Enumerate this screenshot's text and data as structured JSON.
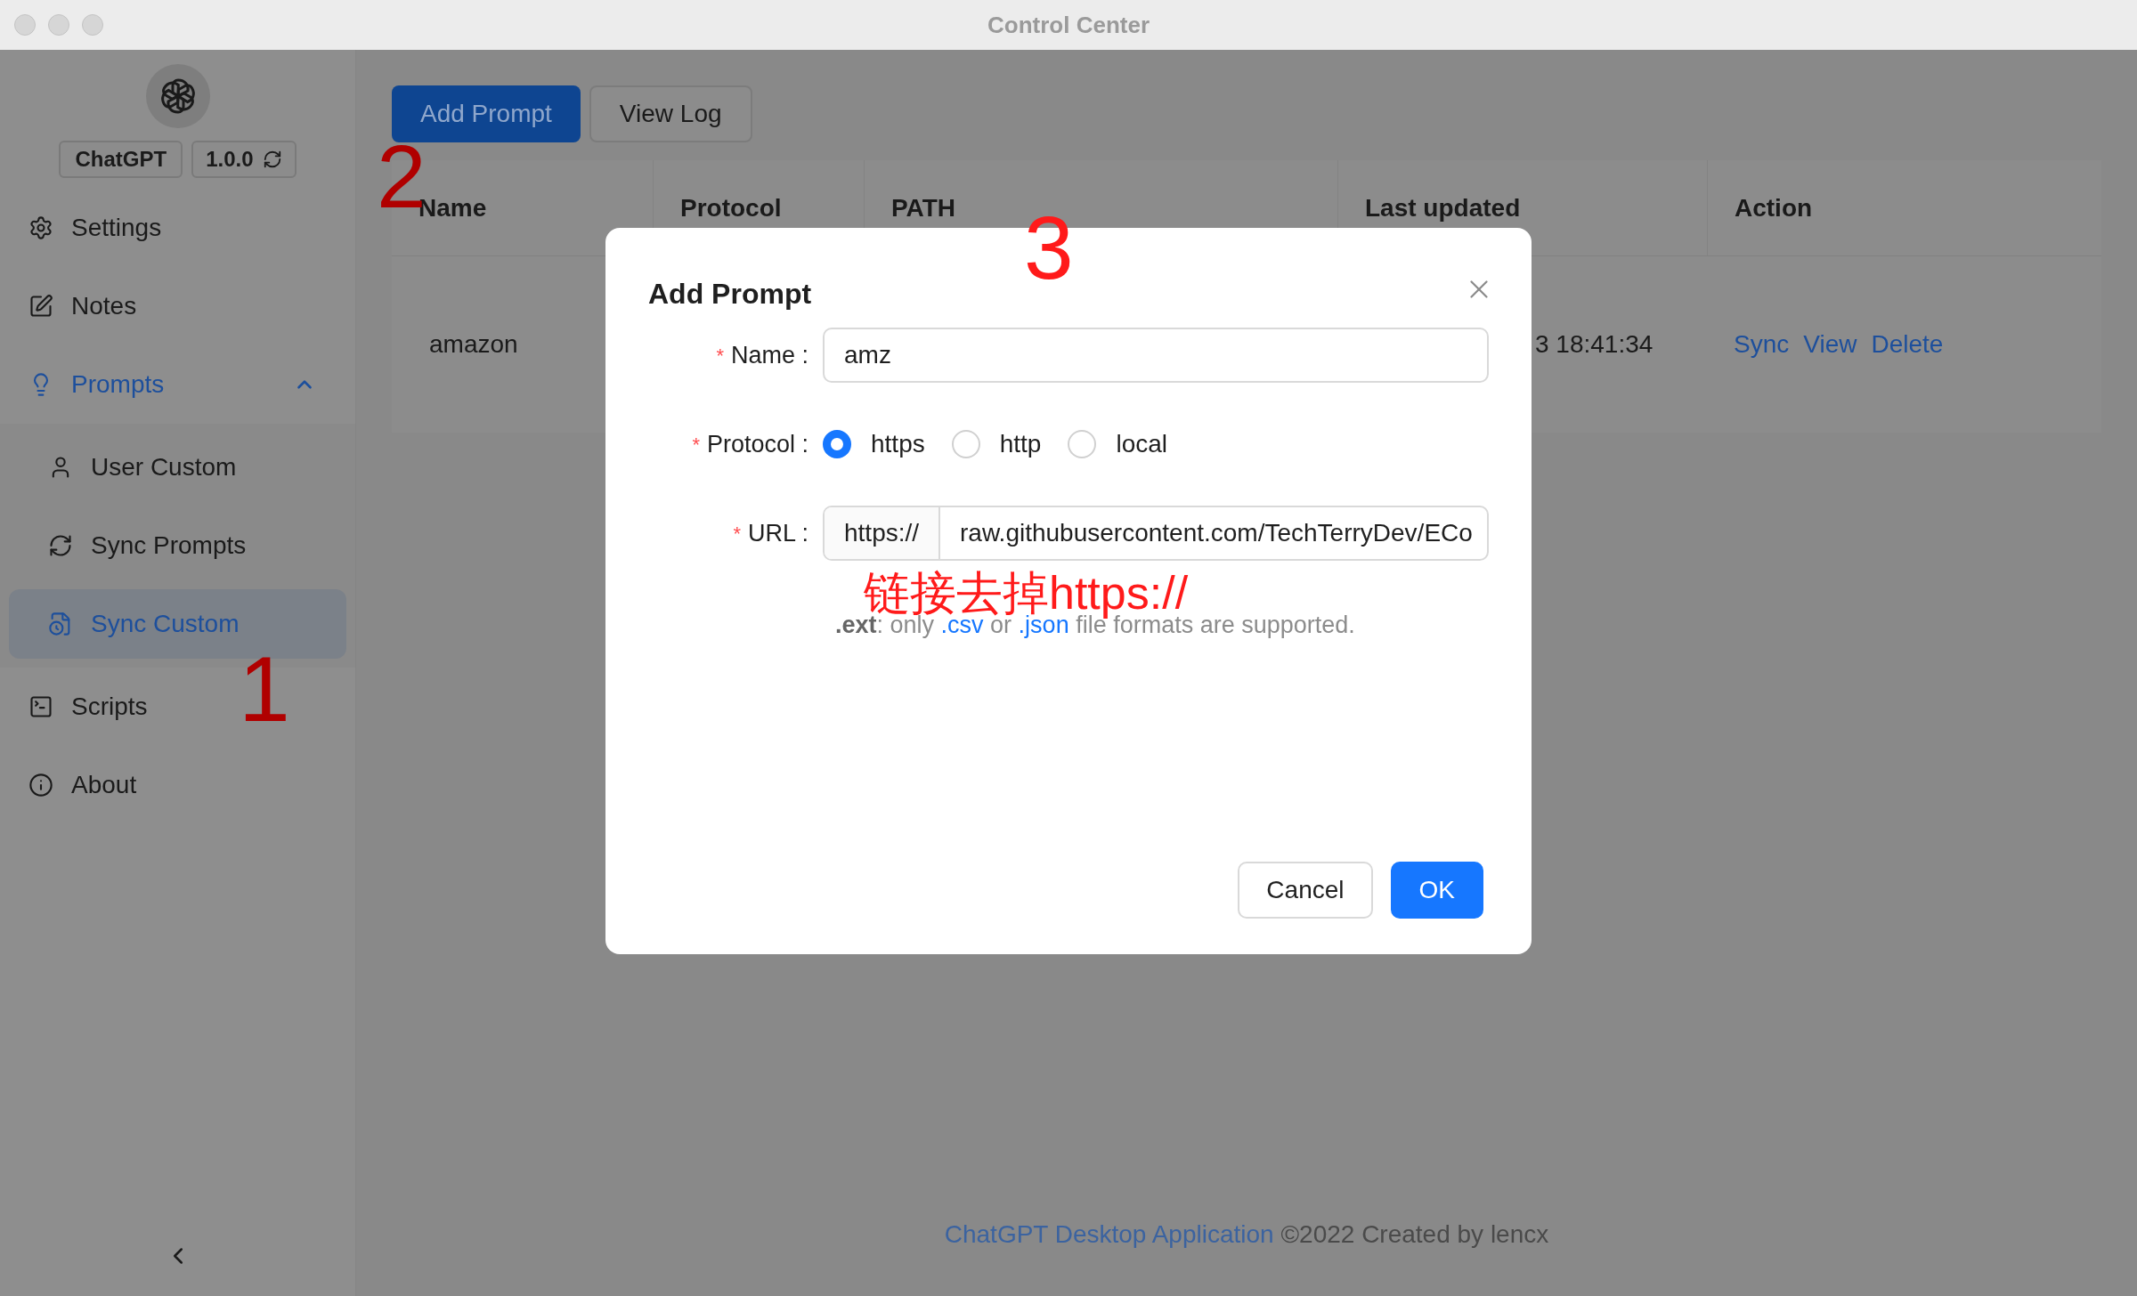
{
  "window": {
    "title": "Control Center"
  },
  "sidebar": {
    "app_name": "ChatGPT",
    "version": "1.0.0",
    "items": [
      {
        "label": "Settings",
        "selected": false
      },
      {
        "label": "Notes",
        "selected": false
      },
      {
        "label": "Prompts",
        "selected": false,
        "expanded": true,
        "children": [
          {
            "label": "User Custom",
            "selected": false
          },
          {
            "label": "Sync Prompts",
            "selected": false
          },
          {
            "label": "Sync Custom",
            "selected": true
          }
        ]
      },
      {
        "label": "Scripts",
        "selected": false
      },
      {
        "label": "About",
        "selected": false
      }
    ]
  },
  "toolbar": [
    {
      "label": "Add Prompt",
      "kind": "primary"
    },
    {
      "label": "View Log",
      "kind": "default"
    }
  ],
  "table": {
    "columns": [
      "Name",
      "Protocol",
      "PATH",
      "Last updated",
      "Action"
    ],
    "rows": [
      {
        "name": "amazon",
        "last_updated": "3 18:41:34",
        "actions": [
          "Sync",
          "View",
          "Delete"
        ]
      }
    ]
  },
  "dialog": {
    "title": "Add Prompt",
    "name_field": {
      "required_mark": "*",
      "label": "Name :",
      "value": "amz"
    },
    "protocol_field": {
      "required_mark": "*",
      "label": "Protocol :",
      "options": [
        {
          "label": "https",
          "selected": true
        },
        {
          "label": "http",
          "selected": false
        },
        {
          "label": "local",
          "selected": false
        }
      ]
    },
    "url_field": {
      "required_mark": "*",
      "label": "URL :",
      "addon": "https://",
      "value": "raw.githubusercontent.com/TechTerryDev/ECo"
    },
    "help": [
      {
        "text": ".ext",
        "kind": "bold"
      },
      {
        "text": ": only ",
        "kind": "plain"
      },
      {
        "text": ".csv",
        "kind": "link"
      },
      {
        "text": " or ",
        "kind": "plain"
      },
      {
        "text": ".json",
        "kind": "link"
      },
      {
        "text": " file formats are supported.",
        "kind": "plain"
      }
    ],
    "buttons": [
      {
        "label": "Cancel",
        "kind": "default"
      },
      {
        "label": "OK",
        "kind": "primary"
      }
    ]
  },
  "footer": {
    "link": "ChatGPT Desktop Application",
    "text": "©2022 Created by lencx"
  },
  "annotations": [
    {
      "text": "1"
    },
    {
      "text": "2"
    },
    {
      "text": "3"
    },
    {
      "text": "链接去掉https://"
    }
  ]
}
